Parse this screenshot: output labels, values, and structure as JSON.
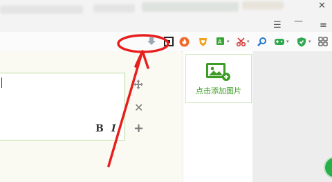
{
  "titlebar": {
    "controls": {
      "menu_icon": "hamburger-icon",
      "minimize_icon": "minimize-icon",
      "close_icon": "close-icon"
    }
  },
  "toolbar": {
    "icons": [
      "download-arrow-icon",
      "screenshot-frame-icon",
      "fire-extension-icon",
      "heart-badge-icon",
      "translate-icon",
      "scissors-icon",
      "search-icon",
      "gamepad-icon",
      "shield-icon",
      "grid-apps-icon"
    ]
  },
  "editor": {
    "bold_label": "B",
    "italic_label": "I",
    "side_tools": {
      "move": "move-icon",
      "delete": "close-icon",
      "add": "plus-icon"
    }
  },
  "panel": {
    "add_image_label": "点击添加图片",
    "icon": "image-add-icon"
  },
  "colors": {
    "accent_green": "#3c9c24",
    "annotation_red": "#e81e1e",
    "editor_border": "#b9dca0"
  }
}
